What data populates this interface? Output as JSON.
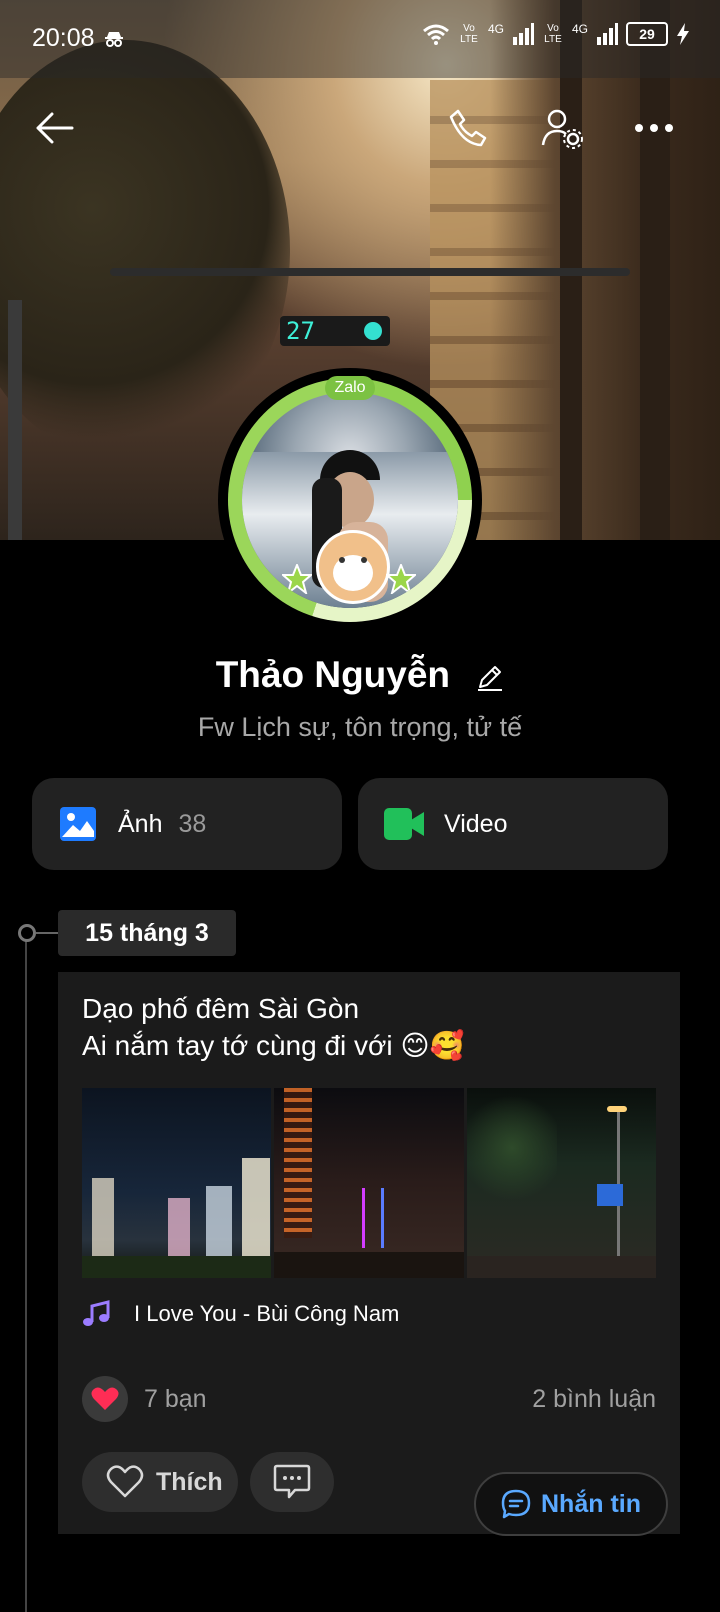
{
  "status_bar": {
    "time": "20:08",
    "battery": "29",
    "net1": "4G",
    "net2": "4G",
    "volte1": "Vo LTE",
    "volte2": "Vo LTE"
  },
  "cover": {
    "signal_number": "27"
  },
  "header": {
    "back_icon": "back-arrow-icon",
    "call_icon": "phone-icon",
    "settings_icon": "user-settings-icon",
    "more_icon": "more-icon"
  },
  "profile": {
    "frame_label": "Zalo",
    "name": "Thảo Nguyễn",
    "bio": "Fw Lịch sự, tôn trọng, tử tế"
  },
  "media": {
    "photos": {
      "label": "Ảnh",
      "count": "38"
    },
    "video": {
      "label": "Video"
    }
  },
  "timeline": {
    "date": "15 tháng 3"
  },
  "post": {
    "line1": "Dạo phố đêm Sài Gòn",
    "line2": "Ai nắm tay tớ cùng đi với 😊🥰",
    "music": "I Love You - Bùi Công Nam",
    "likes": "7 bạn",
    "comments": "2 bình luận",
    "like_label": "Thích"
  },
  "message_button": {
    "label": "Nhắn tin"
  },
  "colors": {
    "accent": "#5aa9ff",
    "photo_icon": "#1e7bff",
    "video_icon": "#21c05a",
    "zalo_green": "#7cc242"
  }
}
